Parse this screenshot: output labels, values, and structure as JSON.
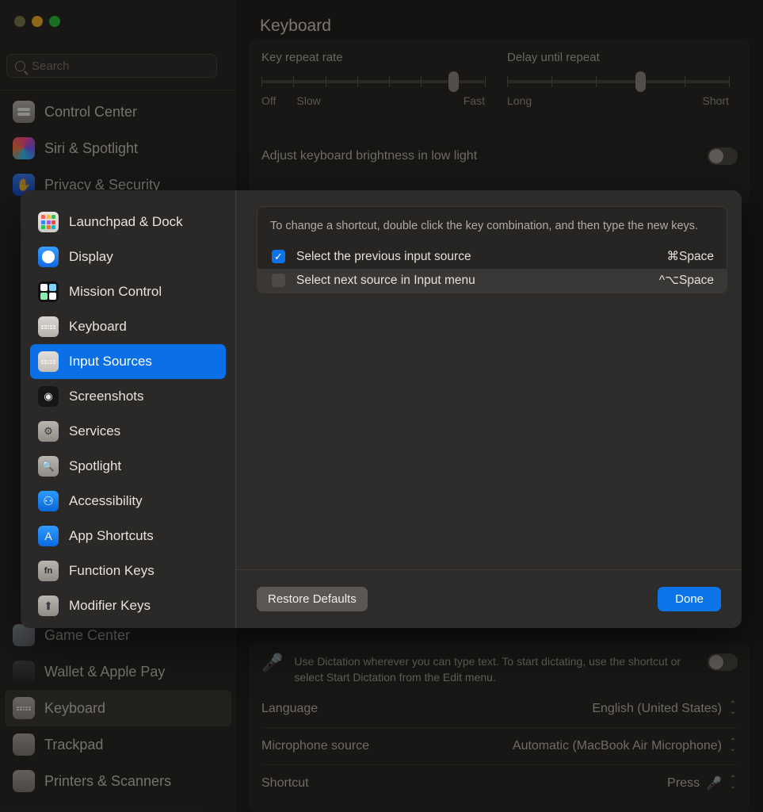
{
  "window": {
    "traffic_lights": [
      "close",
      "minimize",
      "zoom"
    ],
    "search_placeholder": "Search",
    "title": "Keyboard"
  },
  "sidebar": {
    "items": [
      {
        "label": "Control Center",
        "icon": "control-center-icon",
        "selected": false
      },
      {
        "label": "Siri & Spotlight",
        "icon": "siri-icon",
        "selected": false
      },
      {
        "label": "Privacy & Security",
        "icon": "privacy-icon",
        "selected": false
      },
      {
        "label": "Game Center",
        "icon": "game-center-icon",
        "selected": false
      },
      {
        "label": "Wallet & Apple Pay",
        "icon": "wallet-icon",
        "selected": false
      },
      {
        "label": "Keyboard",
        "icon": "keyboard-icon",
        "selected": true
      },
      {
        "label": "Trackpad",
        "icon": "trackpad-icon",
        "selected": false
      },
      {
        "label": "Printers & Scanners",
        "icon": "printer-icon",
        "selected": false
      }
    ]
  },
  "keyboard_pane": {
    "key_repeat": {
      "label": "Key repeat rate",
      "min_label": "Off",
      "low_label": "Slow",
      "max_label": "Fast",
      "ticks": 8,
      "value_index": 7
    },
    "delay_repeat": {
      "label": "Delay until repeat",
      "min_label": "Long",
      "max_label": "Short",
      "ticks": 6,
      "value_index": 4
    },
    "brightness_row": {
      "label": "Adjust keyboard brightness in low light",
      "toggle_on": false
    }
  },
  "dictation": {
    "icon": "microphone-icon",
    "description": "Use Dictation wherever you can type text. To start dictating, use the shortcut or select Start Dictation from the Edit menu.",
    "toggle_on": false,
    "rows": [
      {
        "label": "Language",
        "value": "English (United States)",
        "control": "popup-button"
      },
      {
        "label": "Microphone source",
        "value": "Automatic (MacBook Air Microphone)",
        "control": "popup-button"
      },
      {
        "label": "Shortcut",
        "value": "Press",
        "control": "popup-button",
        "trailing_icon": "microphone-icon"
      }
    ]
  },
  "shortcuts_sheet": {
    "categories": [
      {
        "label": "Launchpad & Dock",
        "icon": "launchpad-icon",
        "selected": false
      },
      {
        "label": "Display",
        "icon": "display-icon",
        "selected": false
      },
      {
        "label": "Mission Control",
        "icon": "mission-control-icon",
        "selected": false
      },
      {
        "label": "Keyboard",
        "icon": "keyboard-icon",
        "selected": false
      },
      {
        "label": "Input Sources",
        "icon": "input-sources-icon",
        "selected": true
      },
      {
        "label": "Screenshots",
        "icon": "screenshots-icon",
        "selected": false
      },
      {
        "label": "Services",
        "icon": "services-icon",
        "selected": false
      },
      {
        "label": "Spotlight",
        "icon": "spotlight-icon",
        "selected": false
      },
      {
        "label": "Accessibility",
        "icon": "accessibility-icon",
        "selected": false
      },
      {
        "label": "App Shortcuts",
        "icon": "app-shortcuts-icon",
        "selected": false
      },
      {
        "label": "Function Keys",
        "icon": "function-keys-icon",
        "selected": false
      },
      {
        "label": "Modifier Keys",
        "icon": "modifier-keys-icon",
        "selected": false
      }
    ],
    "instruction": "To change a shortcut, double click the key combination, and then type the new keys.",
    "shortcuts": [
      {
        "name": "Select the previous input source",
        "keys": "⌘Space",
        "checked": true,
        "selected": false
      },
      {
        "name": "Select next source in Input menu",
        "keys": "^⌥Space",
        "checked": false,
        "selected": true
      }
    ],
    "restore_label": "Restore Defaults",
    "done_label": "Done",
    "accent_color": "#0b74e8"
  }
}
